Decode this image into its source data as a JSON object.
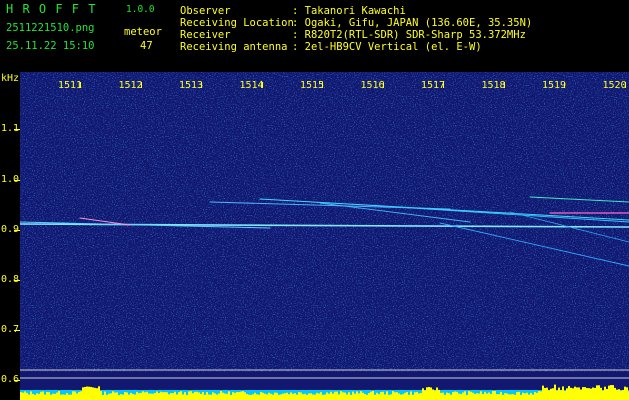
{
  "header": {
    "app_title": "H R O F F T",
    "version": "1.0.0",
    "filename": "2511221510.png",
    "datetime": "25.11.22 15:10",
    "meteor_label": "meteor",
    "meteor_count": "47",
    "observer_label": "Observer",
    "observer_value": ": Takanori Kawachi",
    "location_label": "Receiving Location",
    "location_value": ": Ogaki, Gifu, JAPAN (136.60E, 35.35N)",
    "receiver_label": "Receiver",
    "receiver_value": ": R820T2(RTL-SDR) SDR-Sharp 53.372MHz",
    "antenna_label": "Receiving antenna",
    "antenna_value": ": 2el-HB9CV Vertical (el. E-W)"
  },
  "axis": {
    "y_unit": "kHz",
    "y_ticks": [
      "1.1",
      "1.0",
      "0.9",
      "0.8",
      "0.7",
      "0.6"
    ],
    "x_ticks": [
      "1511",
      "1512",
      "1513",
      "1514",
      "1515",
      "1516",
      "1517",
      "1518",
      "1519",
      "1520"
    ]
  },
  "colors": {
    "text_green": "#22e33a",
    "text_yellow": "#ffff20",
    "background": "#121870",
    "meter_yellow": "#ffff00",
    "meter_cyan": "#00c8ff"
  }
}
